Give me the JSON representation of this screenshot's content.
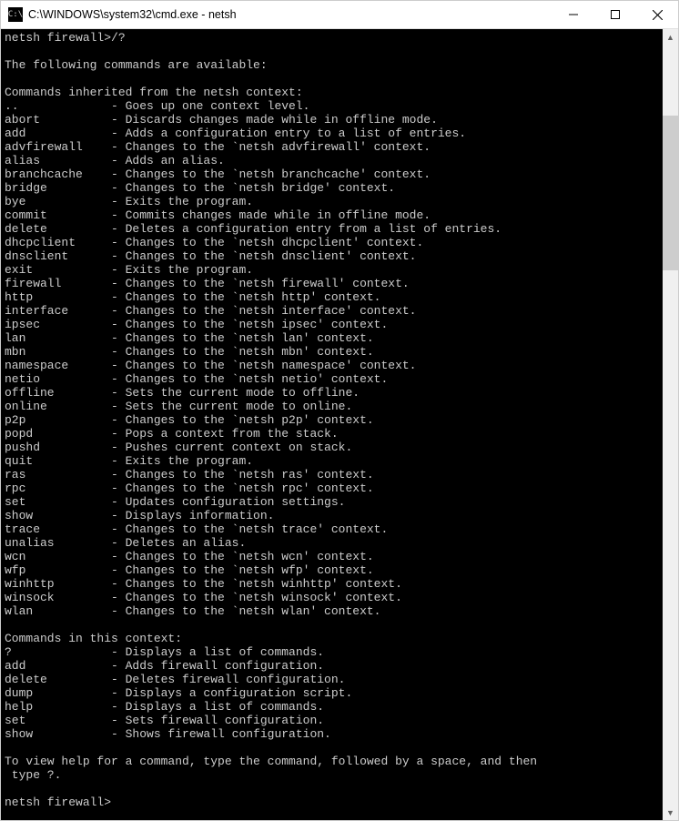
{
  "window": {
    "title": "C:\\WINDOWS\\system32\\cmd.exe - netsh"
  },
  "console": {
    "prompt1": "netsh firewall>/?",
    "blank": "",
    "intro": "The following commands are available:",
    "section1": "Commands inherited from the netsh context:",
    "inherited": [
      {
        "cmd": "..",
        "desc": "- Goes up one context level."
      },
      {
        "cmd": "abort",
        "desc": "- Discards changes made while in offline mode."
      },
      {
        "cmd": "add",
        "desc": "- Adds a configuration entry to a list of entries."
      },
      {
        "cmd": "advfirewall",
        "desc": "- Changes to the `netsh advfirewall' context."
      },
      {
        "cmd": "alias",
        "desc": "- Adds an alias."
      },
      {
        "cmd": "branchcache",
        "desc": "- Changes to the `netsh branchcache' context."
      },
      {
        "cmd": "bridge",
        "desc": "- Changes to the `netsh bridge' context."
      },
      {
        "cmd": "bye",
        "desc": "- Exits the program."
      },
      {
        "cmd": "commit",
        "desc": "- Commits changes made while in offline mode."
      },
      {
        "cmd": "delete",
        "desc": "- Deletes a configuration entry from a list of entries."
      },
      {
        "cmd": "dhcpclient",
        "desc": "- Changes to the `netsh dhcpclient' context."
      },
      {
        "cmd": "dnsclient",
        "desc": "- Changes to the `netsh dnsclient' context."
      },
      {
        "cmd": "exit",
        "desc": "- Exits the program."
      },
      {
        "cmd": "firewall",
        "desc": "- Changes to the `netsh firewall' context."
      },
      {
        "cmd": "http",
        "desc": "- Changes to the `netsh http' context."
      },
      {
        "cmd": "interface",
        "desc": "- Changes to the `netsh interface' context."
      },
      {
        "cmd": "ipsec",
        "desc": "- Changes to the `netsh ipsec' context."
      },
      {
        "cmd": "lan",
        "desc": "- Changes to the `netsh lan' context."
      },
      {
        "cmd": "mbn",
        "desc": "- Changes to the `netsh mbn' context."
      },
      {
        "cmd": "namespace",
        "desc": "- Changes to the `netsh namespace' context."
      },
      {
        "cmd": "netio",
        "desc": "- Changes to the `netsh netio' context."
      },
      {
        "cmd": "offline",
        "desc": "- Sets the current mode to offline."
      },
      {
        "cmd": "online",
        "desc": "- Sets the current mode to online."
      },
      {
        "cmd": "p2p",
        "desc": "- Changes to the `netsh p2p' context."
      },
      {
        "cmd": "popd",
        "desc": "- Pops a context from the stack."
      },
      {
        "cmd": "pushd",
        "desc": "- Pushes current context on stack."
      },
      {
        "cmd": "quit",
        "desc": "- Exits the program."
      },
      {
        "cmd": "ras",
        "desc": "- Changes to the `netsh ras' context."
      },
      {
        "cmd": "rpc",
        "desc": "- Changes to the `netsh rpc' context."
      },
      {
        "cmd": "set",
        "desc": "- Updates configuration settings."
      },
      {
        "cmd": "show",
        "desc": "- Displays information."
      },
      {
        "cmd": "trace",
        "desc": "- Changes to the `netsh trace' context."
      },
      {
        "cmd": "unalias",
        "desc": "- Deletes an alias."
      },
      {
        "cmd": "wcn",
        "desc": "- Changes to the `netsh wcn' context."
      },
      {
        "cmd": "wfp",
        "desc": "- Changes to the `netsh wfp' context."
      },
      {
        "cmd": "winhttp",
        "desc": "- Changes to the `netsh winhttp' context."
      },
      {
        "cmd": "winsock",
        "desc": "- Changes to the `netsh winsock' context."
      },
      {
        "cmd": "wlan",
        "desc": "- Changes to the `netsh wlan' context."
      }
    ],
    "section2": "Commands in this context:",
    "context": [
      {
        "cmd": "?",
        "desc": "- Displays a list of commands."
      },
      {
        "cmd": "add",
        "desc": "- Adds firewall configuration."
      },
      {
        "cmd": "delete",
        "desc": "- Deletes firewall configuration."
      },
      {
        "cmd": "dump",
        "desc": "- Displays a configuration script."
      },
      {
        "cmd": "help",
        "desc": "- Displays a list of commands."
      },
      {
        "cmd": "set",
        "desc": "- Sets firewall configuration."
      },
      {
        "cmd": "show",
        "desc": "- Shows firewall configuration."
      }
    ],
    "footer1": "To view help for a command, type the command, followed by a space, and then",
    "footer2": " type ?.",
    "prompt2": "netsh firewall>"
  }
}
